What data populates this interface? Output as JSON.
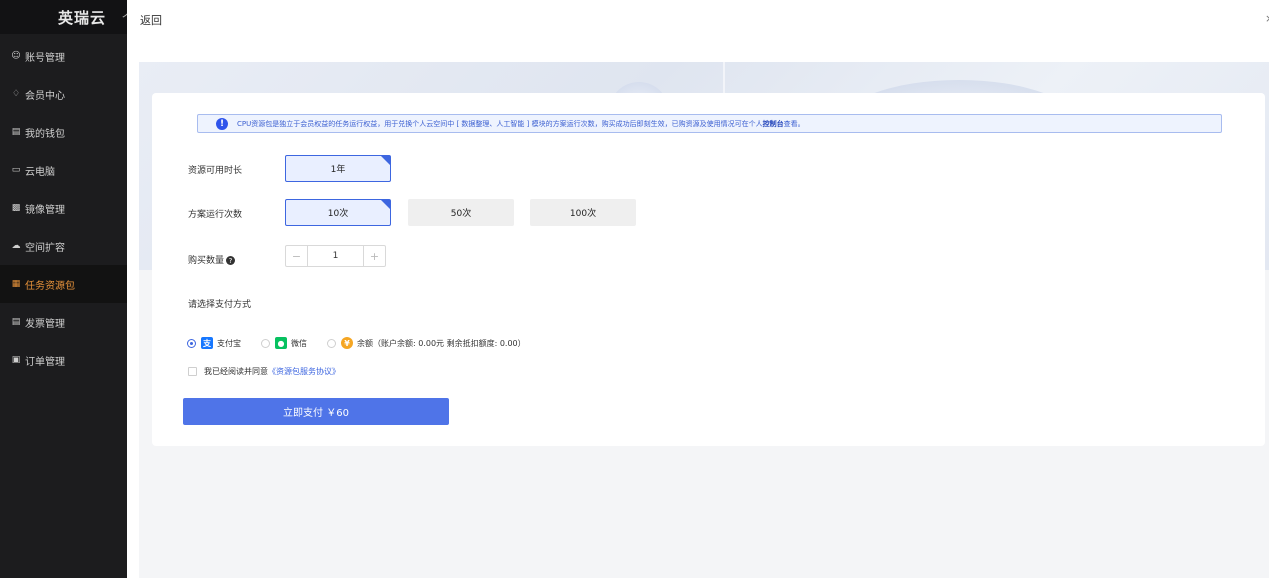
{
  "brand": {
    "logo": "英瑞云",
    "subtitle": "个人"
  },
  "sidebar": {
    "items": [
      {
        "label": "账号管理",
        "icon": "user-icon"
      },
      {
        "label": "会员中心",
        "icon": "diamond-icon"
      },
      {
        "label": "我的钱包",
        "icon": "wallet-icon"
      },
      {
        "label": "云电脑",
        "icon": "computer-icon"
      },
      {
        "label": "镜像管理",
        "icon": "image-icon"
      },
      {
        "label": "空间扩容",
        "icon": "cloud-icon"
      },
      {
        "label": "任务资源包",
        "icon": "package-icon",
        "active": true
      },
      {
        "label": "发票管理",
        "icon": "invoice-icon"
      },
      {
        "label": "订单管理",
        "icon": "order-icon"
      }
    ]
  },
  "header": {
    "back_label": "返回"
  },
  "notice": {
    "text": "CPU资源包是独立于会员权益的任务运行权益，用于兑换个人云空间中 [ 数据整理、人工智能 ] 模块的方案运行次数，购买成功后即刻生效，已购资源及使用情况可在个人",
    "link": "控制台",
    "suffix": "查看。"
  },
  "form": {
    "duration": {
      "label": "资源可用时长",
      "options": [
        "1年"
      ],
      "selected": 0
    },
    "runs": {
      "label": "方案运行次数",
      "options": [
        "10次",
        "50次",
        "100次"
      ],
      "selected": 0
    },
    "quantity": {
      "label": "购买数量",
      "value": "1",
      "minus": "−",
      "plus": "+"
    },
    "payment": {
      "label": "请选择支付方式",
      "options": [
        {
          "label": "支付宝",
          "icon": "alipay-icon",
          "selected": true
        },
        {
          "label": "微信",
          "icon": "wechat-icon",
          "selected": false
        },
        {
          "label": "余额（账户余额: 0.00元 剩余抵扣额度: 0.00）",
          "icon": "balance-icon",
          "selected": false
        }
      ]
    },
    "agreement": {
      "text": "我已经阅读并同意",
      "link": "《资源包服务协议》"
    },
    "submit_label": "立即支付 ￥60"
  },
  "colors": {
    "accent": "#4f74e8",
    "sidebar_bg": "#1c1c1e",
    "active_nav": "#e8933a"
  }
}
